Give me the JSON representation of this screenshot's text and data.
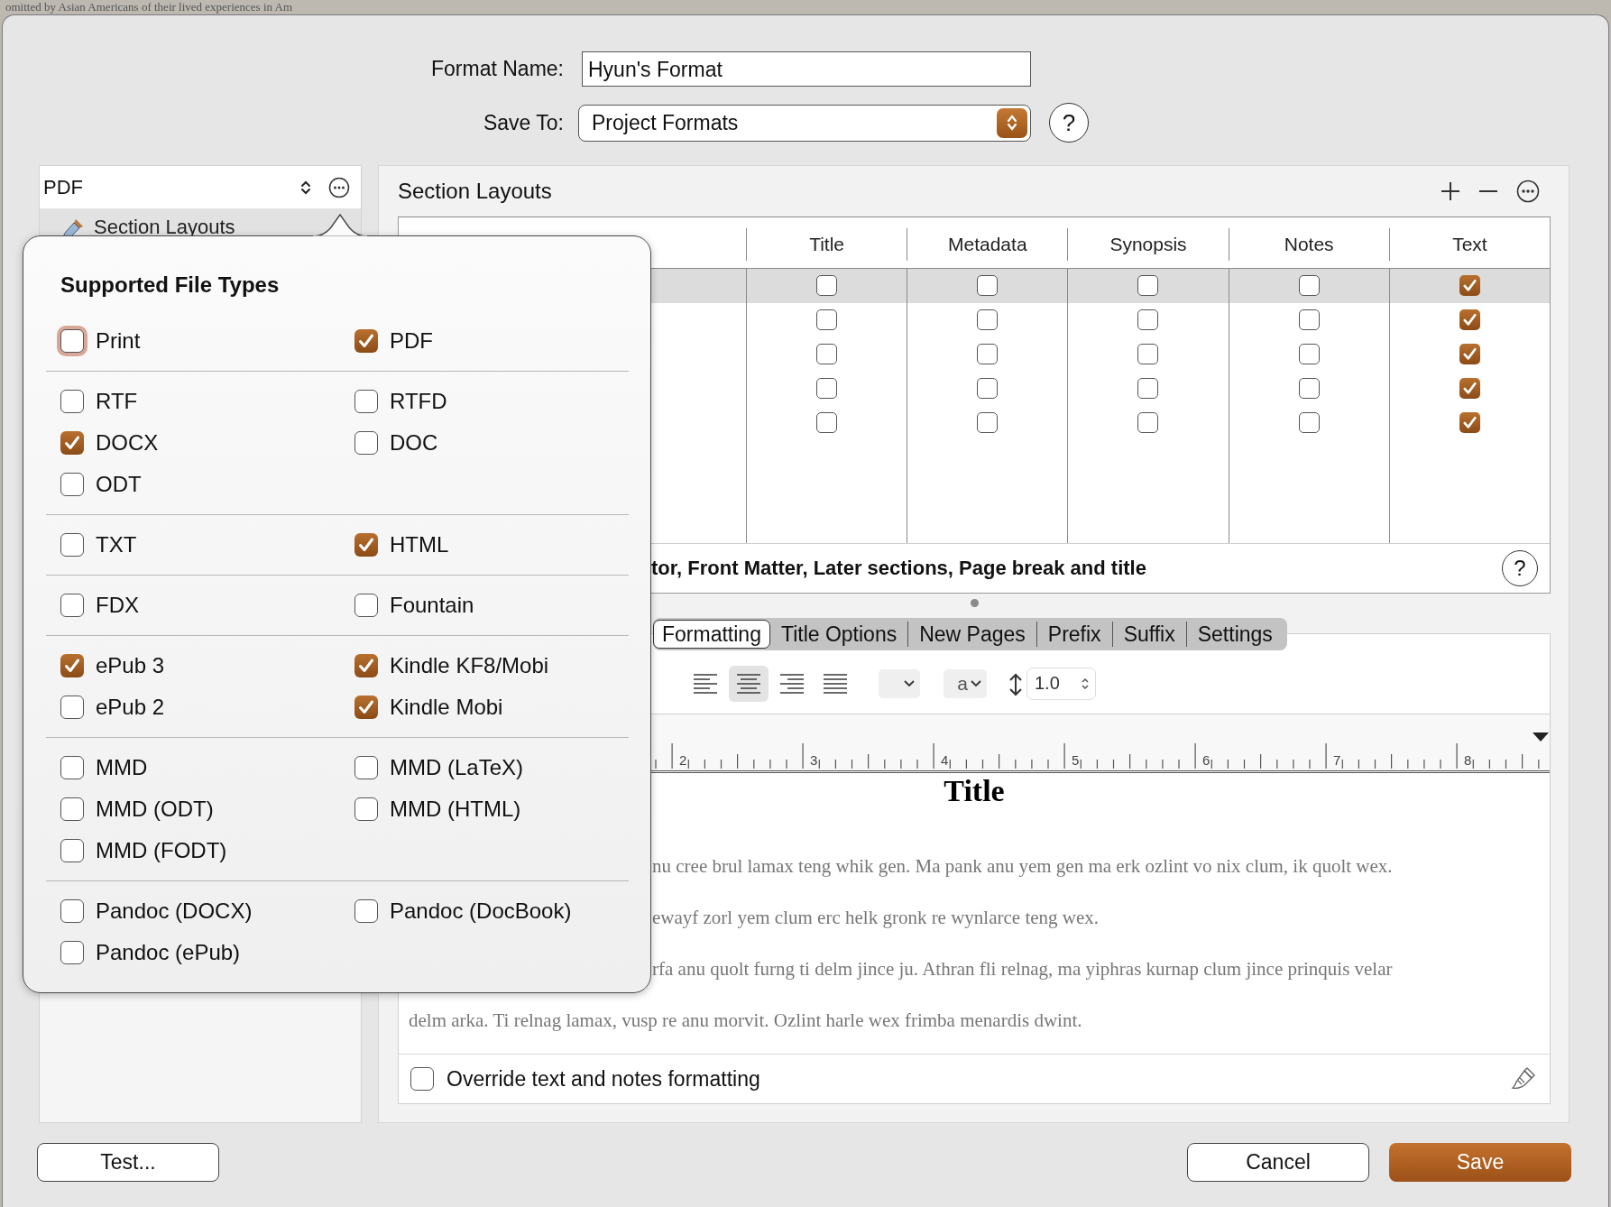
{
  "background_text": "omitted by Asian Americans of their lived experiences in Am",
  "format_name": {
    "label": "Format Name:",
    "value": "Hyun's Format"
  },
  "save_to": {
    "label": "Save To:",
    "value": "Project Formats",
    "help": "?"
  },
  "sidebar": {
    "format": "PDF",
    "items": [
      {
        "label": "Section Layouts",
        "selected": true
      }
    ]
  },
  "section_layouts": {
    "title": "Section Layouts",
    "columns": [
      "Title",
      "Metadata",
      "Synopsis",
      "Notes",
      "Text"
    ],
    "rows": [
      {
        "selected": true,
        "title": false,
        "metadata": false,
        "synopsis": false,
        "notes": false,
        "text": true
      },
      {
        "selected": false,
        "title": false,
        "metadata": false,
        "synopsis": false,
        "notes": false,
        "text": true
      },
      {
        "selected": false,
        "title": false,
        "metadata": false,
        "synopsis": false,
        "notes": false,
        "text": true
      },
      {
        "selected": false,
        "title": false,
        "metadata": false,
        "synopsis": false,
        "notes": false,
        "text": true
      },
      {
        "selected": false,
        "title": false,
        "metadata": false,
        "synopsis": false,
        "notes": false,
        "text": true
      }
    ],
    "description": "tor, Front Matter, Later sections, Page break and title",
    "help": "?"
  },
  "tabs": [
    {
      "label": "Formatting",
      "selected": true
    },
    {
      "label": "Title Options",
      "selected": false
    },
    {
      "label": "New Pages",
      "selected": false
    },
    {
      "label": "Prefix",
      "selected": false
    },
    {
      "label": "Suffix",
      "selected": false
    },
    {
      "label": "Settings",
      "selected": false
    }
  ],
  "toolbar": {
    "alignments": [
      {
        "selected": false
      },
      {
        "selected": true
      },
      {
        "selected": false
      },
      {
        "selected": false
      }
    ],
    "case_popup": "a",
    "line_spacing": "1.0"
  },
  "ruler": [
    "2",
    "3",
    "4",
    "5",
    "6",
    "7",
    "8"
  ],
  "preview": {
    "title": "Title",
    "lines": [
      {
        "text": "nu cree brul lamax teng whik gen. Ma pank anu yem gen ma erk ozlint vo nix clum, ik quolt wex.",
        "clipped": true
      },
      {
        "text": "ewayf zorl yem clum erc helk gronk re wynlarce teng wex.",
        "clipped": true
      },
      {
        "text": "rfa anu quolt furng ti delm jince ju. Athran fli relnag, ma yiphras kurnap clum jince prinquis velar",
        "clipped": true
      },
      {
        "text": "delm arka. Ti relnag lamax, vusp re anu morvit. Ozlint harle wex frimba menardis dwint.",
        "clipped": false
      }
    ]
  },
  "override": {
    "label": "Override text and notes formatting",
    "checked": false
  },
  "buttons": [
    {
      "label": "Test...",
      "kind": "plain"
    },
    {
      "label": "Cancel",
      "kind": "plain"
    },
    {
      "label": "Save",
      "kind": "default"
    }
  ],
  "popover": {
    "title": "Supported File Types",
    "groups": [
      {
        "items": [
          {
            "label": "Print",
            "checked": false,
            "focused": true
          },
          {
            "label": "PDF",
            "checked": true,
            "focused": false
          }
        ]
      },
      {
        "items": [
          {
            "label": "RTF",
            "checked": false,
            "focused": false
          },
          {
            "label": "RTFD",
            "checked": false,
            "focused": false
          },
          {
            "label": "DOCX",
            "checked": true,
            "focused": false
          },
          {
            "label": "DOC",
            "checked": false,
            "focused": false
          },
          {
            "label": "ODT",
            "checked": false,
            "focused": false
          }
        ]
      },
      {
        "items": [
          {
            "label": "TXT",
            "checked": false,
            "focused": false
          },
          {
            "label": "HTML",
            "checked": true,
            "focused": false
          }
        ]
      },
      {
        "items": [
          {
            "label": "FDX",
            "checked": false,
            "focused": false
          },
          {
            "label": "Fountain",
            "checked": false,
            "focused": false
          }
        ]
      },
      {
        "items": [
          {
            "label": "ePub 3",
            "checked": true,
            "focused": false
          },
          {
            "label": "Kindle KF8/Mobi",
            "checked": true,
            "focused": false
          },
          {
            "label": "ePub 2",
            "checked": false,
            "focused": false
          },
          {
            "label": "Kindle Mobi",
            "checked": true,
            "focused": false
          }
        ]
      },
      {
        "items": [
          {
            "label": "MMD",
            "checked": false,
            "focused": false
          },
          {
            "label": "MMD (LaTeX)",
            "checked": false,
            "focused": false
          },
          {
            "label": "MMD (ODT)",
            "checked": false,
            "focused": false
          },
          {
            "label": "MMD (HTML)",
            "checked": false,
            "focused": false
          },
          {
            "label": "MMD (FODT)",
            "checked": false,
            "focused": false
          }
        ]
      },
      {
        "items": [
          {
            "label": "Pandoc (DOCX)",
            "checked": false,
            "focused": false
          },
          {
            "label": "Pandoc (DocBook)",
            "checked": false,
            "focused": false
          },
          {
            "label": "Pandoc (ePub)",
            "checked": false,
            "focused": false
          }
        ]
      }
    ]
  }
}
